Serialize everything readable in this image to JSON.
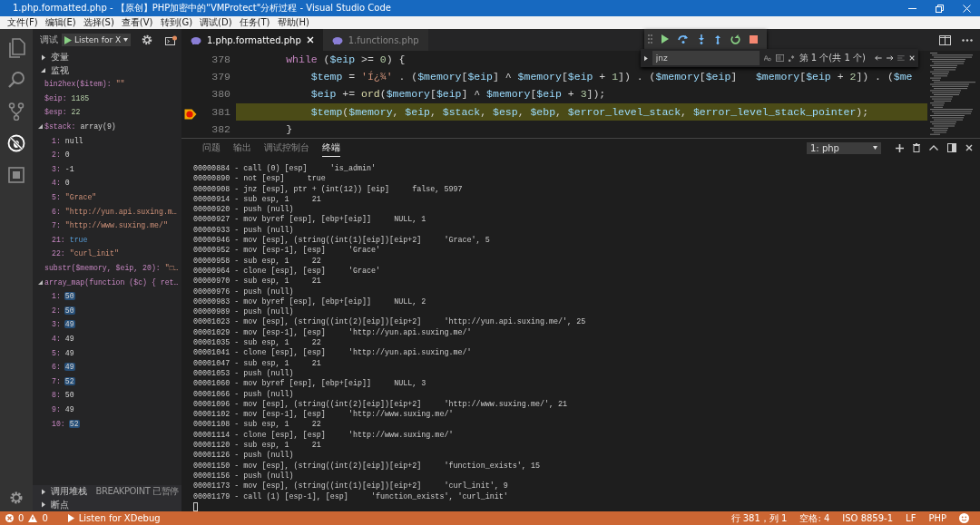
{
  "window": {
    "title": "1.php.formatted.php - 【原创】PHP加密中的\"VMProtect\"分析过程 - Visual Studio Code"
  },
  "menu": [
    "文件(F)",
    "编辑(E)",
    "选择(S)",
    "查看(V)",
    "转到(G)",
    "调试(D)",
    "任务(T)",
    "帮助(H)"
  ],
  "activity_bar": [
    {
      "kind": "files",
      "selected": false
    },
    {
      "kind": "search",
      "selected": false
    },
    {
      "kind": "scm",
      "selected": false
    },
    {
      "kind": "debug",
      "selected": true
    },
    {
      "kind": "extensions",
      "selected": false
    }
  ],
  "sidebar": {
    "title": "调试",
    "configuration": "Listen for X",
    "sections": [
      {
        "title": "变量",
        "expanded": false
      },
      {
        "title": "监视",
        "expanded": true,
        "items": [
          {
            "name": "bin2hex($item):",
            "value": "\"\"",
            "kind": "string"
          },
          {
            "name": "$eip:",
            "value": "1185",
            "kind": "number"
          },
          {
            "name": "$esp:",
            "value": "22",
            "kind": "number"
          },
          {
            "name": "$stack:",
            "value": "array(9)",
            "kind": "plain",
            "expanded": true,
            "children": [
              {
                "name": "1:",
                "value": "null",
                "kind": "plain"
              },
              {
                "name": "2:",
                "value": "0",
                "kind": "plain"
              },
              {
                "name": "3:",
                "value": "-1",
                "kind": "plain"
              },
              {
                "name": "4:",
                "value": "0",
                "kind": "plain"
              },
              {
                "name": "5:",
                "value": "\"Grace\"",
                "kind": "string"
              },
              {
                "name": "6:",
                "value": "\"http://yun.api.suxing.m…",
                "kind": "string"
              },
              {
                "name": "7:",
                "value": "\"http://www.suxing.me/\"",
                "kind": "string"
              },
              {
                "name": "21:",
                "value": "true",
                "kind": "boolean"
              },
              {
                "name": "22:",
                "value": "\"curl_init\"",
                "kind": "string"
              }
            ]
          },
          {
            "name": "substr($memory, $eip, 20):",
            "value": "\"□…",
            "kind": "string"
          },
          {
            "name": "array_map(function ($c) { ret…",
            "expanded": true,
            "children": [
              {
                "name": "1:",
                "value": "50",
                "kind": "plain",
                "changed": true
              },
              {
                "name": "2:",
                "value": "50",
                "kind": "plain",
                "changed": true
              },
              {
                "name": "3:",
                "value": "49",
                "kind": "plain",
                "changed": true
              },
              {
                "name": "4:",
                "value": "49",
                "kind": "plain",
                "changed": false
              },
              {
                "name": "5:",
                "value": "49",
                "kind": "plain",
                "changed": false
              },
              {
                "name": "6:",
                "value": "49",
                "kind": "plain",
                "changed": true
              },
              {
                "name": "7:",
                "value": "52",
                "kind": "plain",
                "changed": true
              },
              {
                "name": "8:",
                "value": "50",
                "kind": "plain",
                "changed": false
              },
              {
                "name": "9:",
                "value": "49",
                "kind": "plain",
                "changed": false
              },
              {
                "name": "10:",
                "value": "52",
                "kind": "plain",
                "changed": true
              }
            ]
          }
        ]
      }
    ],
    "bottom_sections": [
      {
        "title": "调用堆栈",
        "expanded": false,
        "badge": "BREAKPOINT 已暂停"
      },
      {
        "title": "断点",
        "expanded": false
      }
    ]
  },
  "editor": {
    "tabs": [
      {
        "label": "1.php.formatted.php",
        "selected": true
      },
      {
        "label": "1.functions.php",
        "selected": false
      }
    ],
    "lines": [
      {
        "number": "378",
        "breakpoint": false,
        "current": false,
        "segments": [
          {
            "kind": "keyword",
            "text": "        while"
          },
          {
            "kind": "plain",
            "text": " ("
          },
          {
            "kind": "var",
            "text": "$eip"
          },
          {
            "kind": "plain",
            "text": " >= "
          },
          {
            "kind": "number",
            "text": "0"
          },
          {
            "kind": "plain",
            "text": ") {"
          }
        ]
      },
      {
        "number": "379",
        "breakpoint": false,
        "current": false,
        "segments": [
          {
            "kind": "var",
            "text": "            $temp"
          },
          {
            "kind": "plain",
            "text": " = "
          },
          {
            "kind": "string",
            "text": "'Í¿¾'"
          },
          {
            "kind": "plain",
            "text": " . ("
          },
          {
            "kind": "var",
            "text": "$memory"
          },
          {
            "kind": "plain",
            "text": "["
          },
          {
            "kind": "var",
            "text": "$eip"
          },
          {
            "kind": "plain",
            "text": "] ^ "
          },
          {
            "kind": "var",
            "text": "$memory"
          },
          {
            "kind": "plain",
            "text": "["
          },
          {
            "kind": "var",
            "text": "$eip"
          },
          {
            "kind": "plain",
            "text": " + "
          },
          {
            "kind": "number",
            "text": "1"
          },
          {
            "kind": "plain",
            "text": "]) . ("
          },
          {
            "kind": "var",
            "text": "$memory"
          },
          {
            "kind": "plain",
            "text": "["
          },
          {
            "kind": "var",
            "text": "$eip"
          },
          {
            "kind": "plain",
            "text": "]   "
          },
          {
            "kind": "var",
            "text": "$memory"
          },
          {
            "kind": "plain",
            "text": "["
          },
          {
            "kind": "var",
            "text": "$eip"
          },
          {
            "kind": "plain",
            "text": " + "
          },
          {
            "kind": "number",
            "text": "2"
          },
          {
            "kind": "plain",
            "text": "]) . ("
          },
          {
            "kind": "var",
            "text": "$me"
          }
        ]
      },
      {
        "number": "380",
        "breakpoint": false,
        "current": false,
        "segments": [
          {
            "kind": "var",
            "text": "            $eip"
          },
          {
            "kind": "plain",
            "text": " += "
          },
          {
            "kind": "function",
            "text": "ord"
          },
          {
            "kind": "plain",
            "text": "("
          },
          {
            "kind": "var",
            "text": "$memory"
          },
          {
            "kind": "plain",
            "text": "["
          },
          {
            "kind": "var",
            "text": "$eip"
          },
          {
            "kind": "plain",
            "text": "] ^ "
          },
          {
            "kind": "var",
            "text": "$memory"
          },
          {
            "kind": "plain",
            "text": "["
          },
          {
            "kind": "var",
            "text": "$eip"
          },
          {
            "kind": "plain",
            "text": " + "
          },
          {
            "kind": "number",
            "text": "3"
          },
          {
            "kind": "plain",
            "text": "]);"
          }
        ]
      },
      {
        "number": "381",
        "breakpoint": true,
        "current": true,
        "segments": [
          {
            "kind": "var",
            "text": "            $temp"
          },
          {
            "kind": "plain",
            "text": "("
          },
          {
            "kind": "var",
            "text": "$memory"
          },
          {
            "kind": "plain",
            "text": ", "
          },
          {
            "kind": "var",
            "text": "$eip"
          },
          {
            "kind": "plain",
            "text": ", "
          },
          {
            "kind": "var",
            "text": "$stack"
          },
          {
            "kind": "plain",
            "text": ", "
          },
          {
            "kind": "var",
            "text": "$esp"
          },
          {
            "kind": "plain",
            "text": ", "
          },
          {
            "kind": "var",
            "text": "$ebp"
          },
          {
            "kind": "plain",
            "text": ", "
          },
          {
            "kind": "var",
            "text": "$error_level_stack"
          },
          {
            "kind": "plain",
            "text": ", "
          },
          {
            "kind": "var",
            "text": "$error_level_stack_pointer"
          },
          {
            "kind": "plain",
            "text": ");"
          }
        ]
      },
      {
        "number": "382",
        "breakpoint": false,
        "current": false,
        "segments": [
          {
            "kind": "plain",
            "text": "        }"
          }
        ]
      }
    ],
    "find": {
      "value": "jnz",
      "result": "第 1 个(共 1 个)"
    }
  },
  "panel": {
    "tabs": [
      {
        "label": "问题",
        "selected": false
      },
      {
        "label": "输出",
        "selected": false
      },
      {
        "label": "调试控制台",
        "selected": false
      },
      {
        "label": "终端",
        "selected": true
      }
    ],
    "terminal_select": "1: php",
    "lines": [
      "00000884 - call (0) [esp]     'is_admin'",
      "00000890 - not [esp]     true",
      "00000908 - jnz [esp], ptr + (int(12)) [eip]     false, 5997",
      "00000914 - sub esp, 1     21",
      "00000920 - push (null)",
      "00000927 - mov byref [esp], [ebp+[eip]]     NULL, 1",
      "00000933 - push (null)",
      "00000946 - mov [esp], (string((int(1)[eip])[eip+2]     'Grace', 5",
      "00000952 - mov [esp-1], [esp]     'Grace'",
      "00000958 - sub esp, 1     22",
      "00000964 - clone [esp], [esp]     'Grace'",
      "00000970 - sub esp, 1     21",
      "00000976 - push (null)",
      "00000983 - mov byref [esp], [ebp+[eip]]     NULL, 2",
      "00000989 - push (null)",
      "00001023 - mov [esp], (string((int(2)[eip])[eip+2]     'http://yun.api.suxing.me/', 25",
      "00001029 - mov [esp-1], [esp]     'http://yun.api.suxing.me/'",
      "00001035 - sub esp, 1     22",
      "00001041 - clone [esp], [esp]     'http://yun.api.suxing.me/'",
      "00001047 - sub esp, 1     21",
      "00001053 - push (null)",
      "00001060 - mov byref [esp], [ebp+[eip]]     NULL, 3",
      "00001066 - push (null)",
      "00001096 - mov [esp], (string((int(2)[eip])[eip+2]     'http://www.suxing.me/', 21",
      "00001102 - mov [esp-1], [esp]     'http://www.suxing.me/'",
      "00001108 - sub esp, 1     22",
      "00001114 - clone [esp], [esp]     'http://www.suxing.me/'",
      "00001120 - sub esp, 1     21",
      "00001126 - push (null)",
      "00001150 - mov [esp], (string((int(2)[eip])[eip+2]     'function_exists', 15",
      "00001156 - push (null)",
      "00001173 - mov [esp], (string((int(1)[eip])[eip+2]     'curl_init', 9",
      "00001179 - call (1) [esp-1], [esp]     'function_exists', 'curl_init'"
    ]
  },
  "status_bar": {
    "errors": "0",
    "warnings": "0",
    "debug_target": "Listen for XDebug",
    "items": [
      "行 381，列 1",
      "空格: 4",
      "ISO 8859-1",
      "LF",
      "PHP"
    ]
  }
}
